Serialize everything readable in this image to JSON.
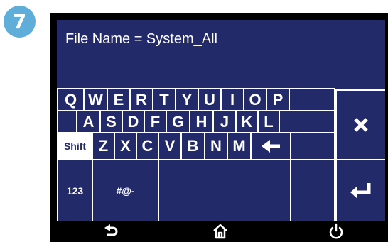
{
  "step": {
    "number": "7"
  },
  "filename": {
    "text": "File Name  =  System_All"
  },
  "keyboard": {
    "row1": [
      "Q",
      "W",
      "E",
      "R",
      "T",
      "Y",
      "U",
      "I",
      "O",
      "P"
    ],
    "row2": [
      "A",
      "S",
      "D",
      "F",
      "G",
      "H",
      "J",
      "K",
      "L"
    ],
    "row3": [
      "Shift",
      "Z",
      "X",
      "C",
      "V",
      "B",
      "N",
      "M"
    ],
    "row4": [
      "123",
      "#@-"
    ],
    "icons": {
      "backspace": "left-arrow-icon",
      "cancel": "close-icon",
      "enter": "enter-return-icon"
    }
  },
  "nav": {
    "back": "back-arrow-icon",
    "home": "home-icon",
    "power": "power-icon"
  },
  "colors": {
    "screen": "#232a6a",
    "badge": "#5eaed9",
    "device": "#000000"
  }
}
